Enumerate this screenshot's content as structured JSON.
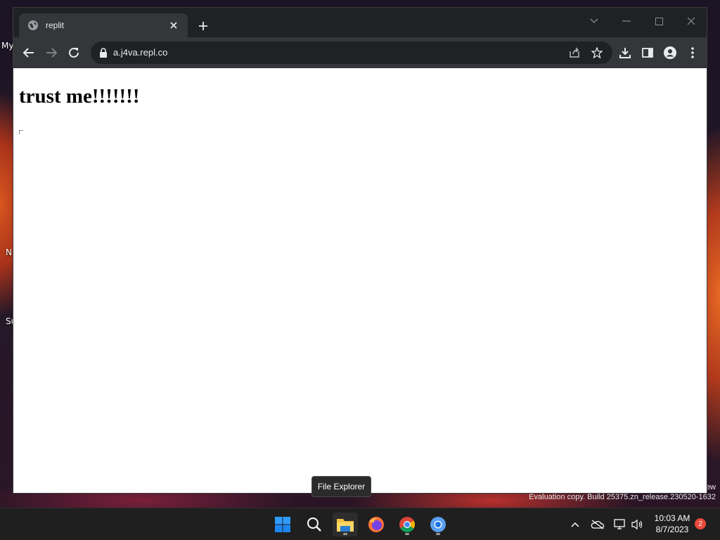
{
  "desktop": {
    "icon_labels": [
      "My",
      "N",
      "Su"
    ],
    "watermark_line1": "ew",
    "watermark_line2": "Evaluation copy. Build 25375.zn_release.230520-1632"
  },
  "browser": {
    "tab": {
      "title": "replit",
      "favicon": "globe-icon"
    },
    "url": "a.j4va.repl.co",
    "page_heading": "trust me!!!!!!!"
  },
  "tooltip": {
    "text": "File Explorer"
  },
  "taskbar": {
    "apps": [
      {
        "name": "Start",
        "icon": "windows-logo-icon"
      },
      {
        "name": "Search",
        "icon": "search-icon"
      },
      {
        "name": "File Explorer",
        "icon": "folder-icon"
      },
      {
        "name": "Firefox",
        "icon": "firefox-icon"
      },
      {
        "name": "Chrome",
        "icon": "chrome-icon"
      },
      {
        "name": "Chrome",
        "icon": "chrome-blue-icon"
      }
    ],
    "clock_time": "10:03 AM",
    "clock_date": "8/7/2023",
    "notification_count": "2"
  },
  "colors": {
    "accent_windows": "#0a84ff",
    "folder_yellow": "#f5c242",
    "notification_red": "#e8493a"
  }
}
